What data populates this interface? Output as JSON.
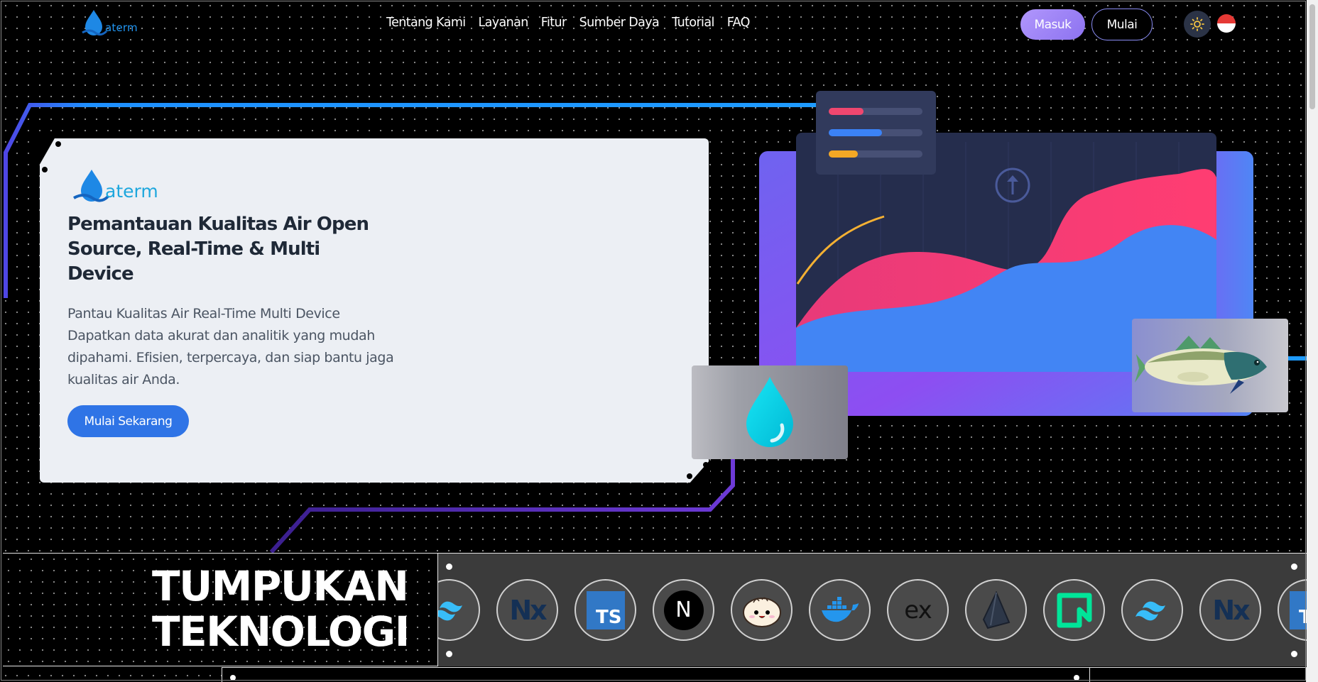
{
  "header": {
    "logo_text": "aterm",
    "nav": [
      "Tentang Kami",
      "Layanan",
      "Fitur",
      "Sumber Daya",
      "Tutorial",
      "FAQ"
    ],
    "login_label": "Masuk",
    "start_label": "Mulai",
    "theme_icon": "sun-icon",
    "language_icon": "indonesia-flag-icon"
  },
  "hero": {
    "logo_text": "aterm",
    "title": "Pemantauan Kualitas Air Open Source, Real-Time & Multi Device",
    "desc_lines": [
      "Pantau Kualitas Air Real-Time Multi Device",
      "Dapatkan data akurat dan analitik yang mudah",
      "dipahami. Efisien, terpercaya, dan siap bantu jaga",
      "kualitas air Anda."
    ],
    "cta_label": "Mulai Sekarang"
  },
  "illustration": {
    "icons": [
      "upload-arrow-icon",
      "water-drop-icon",
      "fish-icon"
    ],
    "progress_bars": [
      {
        "color": "#ef476f",
        "level": 0.37
      },
      {
        "color": "#3b82f6",
        "level": 0.57
      },
      {
        "color": "#f4a825",
        "level": 0.31
      }
    ],
    "colors": {
      "pink": "#ff3b77",
      "blue": "#4285f4",
      "purple": "#8b5cf6",
      "navy": "#252d4d",
      "gold": "#f5b133"
    }
  },
  "tech_stack": {
    "title_lines": [
      "TUMPUKAN",
      "TEKNOLOGI"
    ],
    "icons": [
      {
        "name": "tailwind-icon",
        "text": ""
      },
      {
        "name": "nx-icon",
        "text": "Nx"
      },
      {
        "name": "typescript-icon",
        "text": "TS"
      },
      {
        "name": "nextjs-icon",
        "text": "N"
      },
      {
        "name": "bun-icon",
        "text": ""
      },
      {
        "name": "docker-icon",
        "text": ""
      },
      {
        "name": "express-icon",
        "text": "ex"
      },
      {
        "name": "prisma-icon",
        "text": ""
      },
      {
        "name": "neon-icon",
        "text": ""
      },
      {
        "name": "tailwind-icon",
        "text": ""
      },
      {
        "name": "nx-icon",
        "text": "Nx"
      },
      {
        "name": "typescript-icon",
        "text": "TS"
      }
    ]
  }
}
